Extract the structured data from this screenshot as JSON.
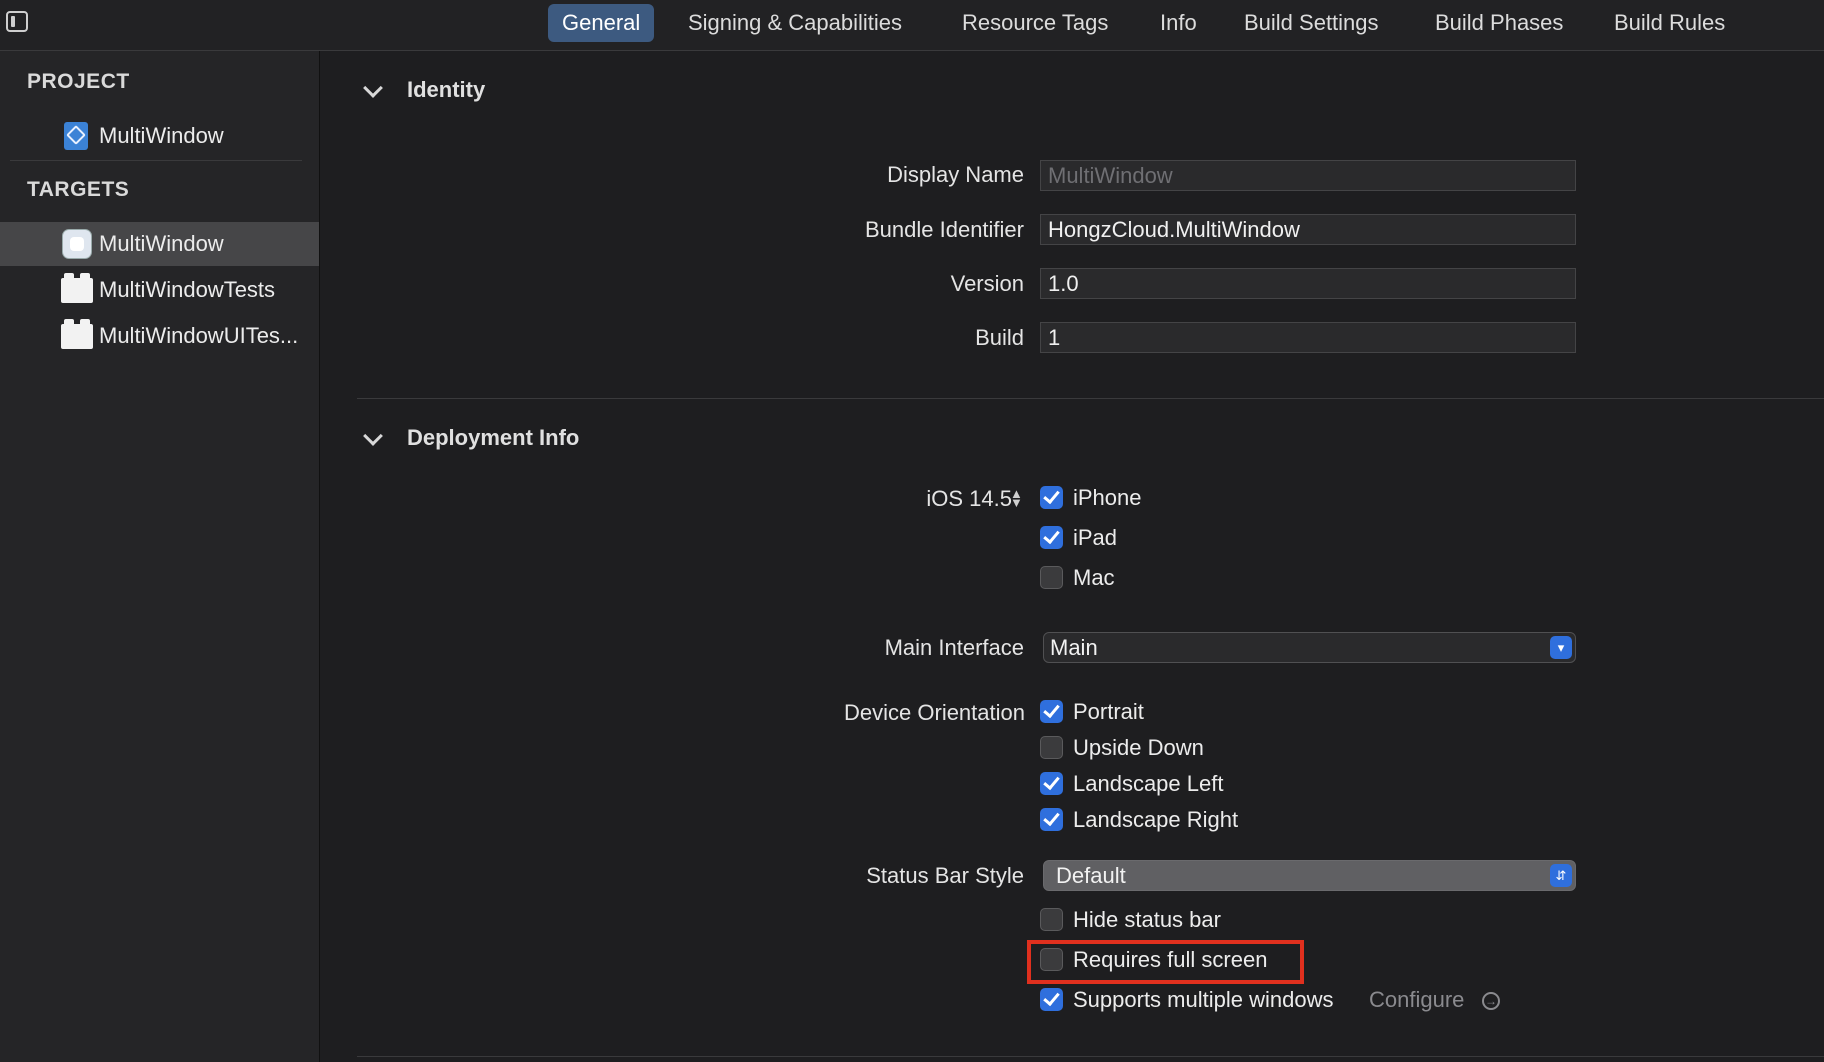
{
  "tabs": [
    {
      "label": "General",
      "active": true
    },
    {
      "label": "Signing & Capabilities"
    },
    {
      "label": "Resource Tags"
    },
    {
      "label": "Info"
    },
    {
      "label": "Build Settings"
    },
    {
      "label": "Build Phases"
    },
    {
      "label": "Build Rules"
    }
  ],
  "sidebar": {
    "project_heading": "PROJECT",
    "project_item": "MultiWindow",
    "targets_heading": "TARGETS",
    "targets": [
      {
        "label": "MultiWindow",
        "selected": true,
        "icon": "app-target-icon"
      },
      {
        "label": "MultiWindowTests",
        "icon": "test-target-icon"
      },
      {
        "label": "MultiWindowUITes...",
        "icon": "test-target-icon"
      }
    ]
  },
  "identity": {
    "title": "Identity",
    "display_name_label": "Display Name",
    "display_name_placeholder": "MultiWindow",
    "bundle_id_label": "Bundle Identifier",
    "bundle_id_value": "HongzCloud.MultiWindow",
    "version_label": "Version",
    "version_value": "1.0",
    "build_label": "Build",
    "build_value": "1"
  },
  "deployment": {
    "title": "Deployment Info",
    "ios_version": "iOS 14.5",
    "devices": [
      {
        "label": "iPhone",
        "checked": true
      },
      {
        "label": "iPad",
        "checked": true
      },
      {
        "label": "Mac",
        "checked": false
      }
    ],
    "main_interface_label": "Main Interface",
    "main_interface_value": "Main",
    "orientation_label": "Device Orientation",
    "orientations": [
      {
        "label": "Portrait",
        "checked": true
      },
      {
        "label": "Upside Down",
        "checked": false
      },
      {
        "label": "Landscape Left",
        "checked": true
      },
      {
        "label": "Landscape Right",
        "checked": true
      }
    ],
    "status_bar_label": "Status Bar Style",
    "status_bar_value": "Default",
    "options": [
      {
        "label": "Hide status bar",
        "checked": false
      },
      {
        "label": "Requires full screen",
        "checked": false
      },
      {
        "label": "Supports multiple windows",
        "checked": true
      }
    ],
    "configure_label": "Configure"
  },
  "colors": {
    "accent": "#2f6fdd",
    "active_tab": "#3d5a80",
    "highlight_box": "#e0301e"
  }
}
